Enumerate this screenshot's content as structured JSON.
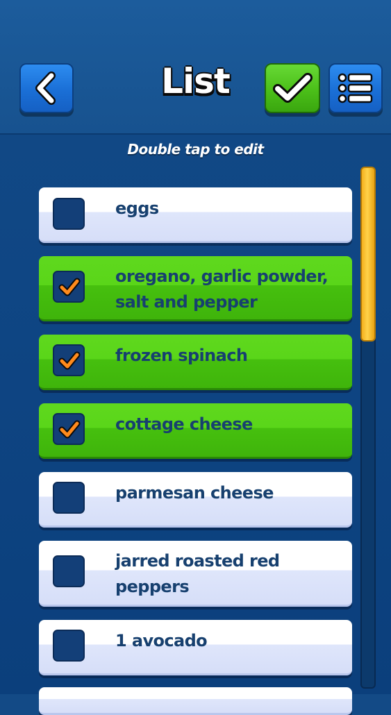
{
  "header": {
    "title": "List",
    "back_icon": "chevron-left-icon",
    "confirm_icon": "checkmark-icon",
    "menu_icon": "list-menu-icon"
  },
  "hint": "Double tap to edit",
  "items": [
    {
      "label": "eggs",
      "checked": false
    },
    {
      "label": "oregano, garlic powder, salt and pepper",
      "checked": true
    },
    {
      "label": "frozen spinach",
      "checked": true
    },
    {
      "label": "cottage cheese",
      "checked": true
    },
    {
      "label": "parmesan cheese",
      "checked": false
    },
    {
      "label": "jarred roasted red peppers",
      "checked": false
    },
    {
      "label": "1 avocado",
      "checked": false
    }
  ],
  "colors": {
    "accent_blue": "#1a6fd6",
    "accent_green": "#4bbf19",
    "check_orange": "#ff8a1c",
    "scroll_yellow": "#ffd24a"
  }
}
